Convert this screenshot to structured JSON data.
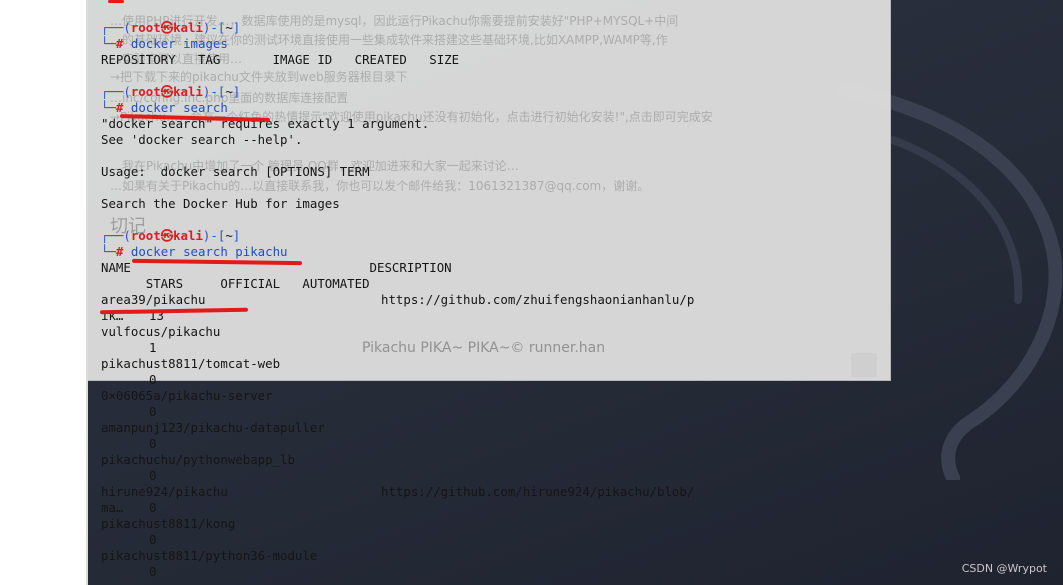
{
  "background_page": {
    "paragraphs": [
      "…使用PHP进行开发…，数据库使用的是mysql，因此运行Pikachu你需要提前安装好\"PHP+MYSQL+中间",
      "…的基础环境，建议在你的测试环境直接使用一些集成软件来搭建这些基础环境,比如XAMPP,WAMP等,作",
      "…实验室可以直接使用…",
      "→把下载下来的pikachu文件夹放到web服务器根目录下",
      "…inc/config.inc.php里面的数据库连接配置",
      "→Pikachu…，会有一个红色的热情提示\"欢迎使用pikachu还没有初始化，点击进行初始化安装!\",点击即可完成安",
      "…我在Pikachu中增加了一个 管理员 QQ群，欢迎加进来和大家一起来讨论…",
      "…如果有关于Pikachu的…以直接联系我，你也可以发个邮件给我：1061321387@qq.com，谢谢。"
    ],
    "heading": "切记",
    "footer": "Pikachu PIKA~ PIKA~© runner.han"
  },
  "terminal": {
    "prompt_user": "root",
    "prompt_at": "㉿",
    "prompt_host": "kali",
    "prompt_dir": "~",
    "prompt_symbol": "#",
    "commands": [
      "docker images",
      "docker search",
      "docker search pikachu"
    ],
    "images_header": "REPOSITORY   TAG       IMAGE ID   CREATED   SIZE",
    "search_error": [
      "\"docker search\" requires exactly 1 argument.",
      "See 'docker search --help'.",
      "",
      "Usage:  docker search [OPTIONS] TERM",
      "",
      "Search the Docker Hub for images"
    ],
    "results_header_1": "NAME                                DESCRIPTION",
    "results_header_2": "      STARS     OFFICIAL   AUTOMATED",
    "results": [
      {
        "name": "area39/pikachu",
        "description": "https://github.com/zhuifengshaonianhanlu/p",
        "extra": "ik…",
        "stars": "13"
      },
      {
        "name": "vulfocus/pikachu",
        "description": "",
        "extra": "",
        "stars": "1"
      },
      {
        "name": "pikachust8811/tomcat-web",
        "description": "",
        "extra": "",
        "stars": "0"
      },
      {
        "name": "0×06065a/pikachu-server",
        "description": "",
        "extra": "",
        "stars": "0"
      },
      {
        "name": "amanpunj123/pikachu-datapuller",
        "description": "",
        "extra": "",
        "stars": "0"
      },
      {
        "name": "pikachuchu/pythonwebapp_lb",
        "description": "",
        "extra": "",
        "stars": "0"
      },
      {
        "name": "hirune924/pikachu",
        "description": "https://github.com/hirune924/pikachu/blob/",
        "extra": "ma…",
        "stars": "0"
      },
      {
        "name": "pikachust8811/kong",
        "description": "",
        "extra": "",
        "stars": "0"
      },
      {
        "name": "pikachust8811/python36-module",
        "description": "",
        "extra": "",
        "stars": "0"
      }
    ]
  },
  "watermark": "CSDN @Wrypot",
  "colors": {
    "prompt_frame": "#2457c8",
    "prompt_user": "#d81e1e",
    "command": "#1f4fc2",
    "annotation": "#e01b1b"
  }
}
